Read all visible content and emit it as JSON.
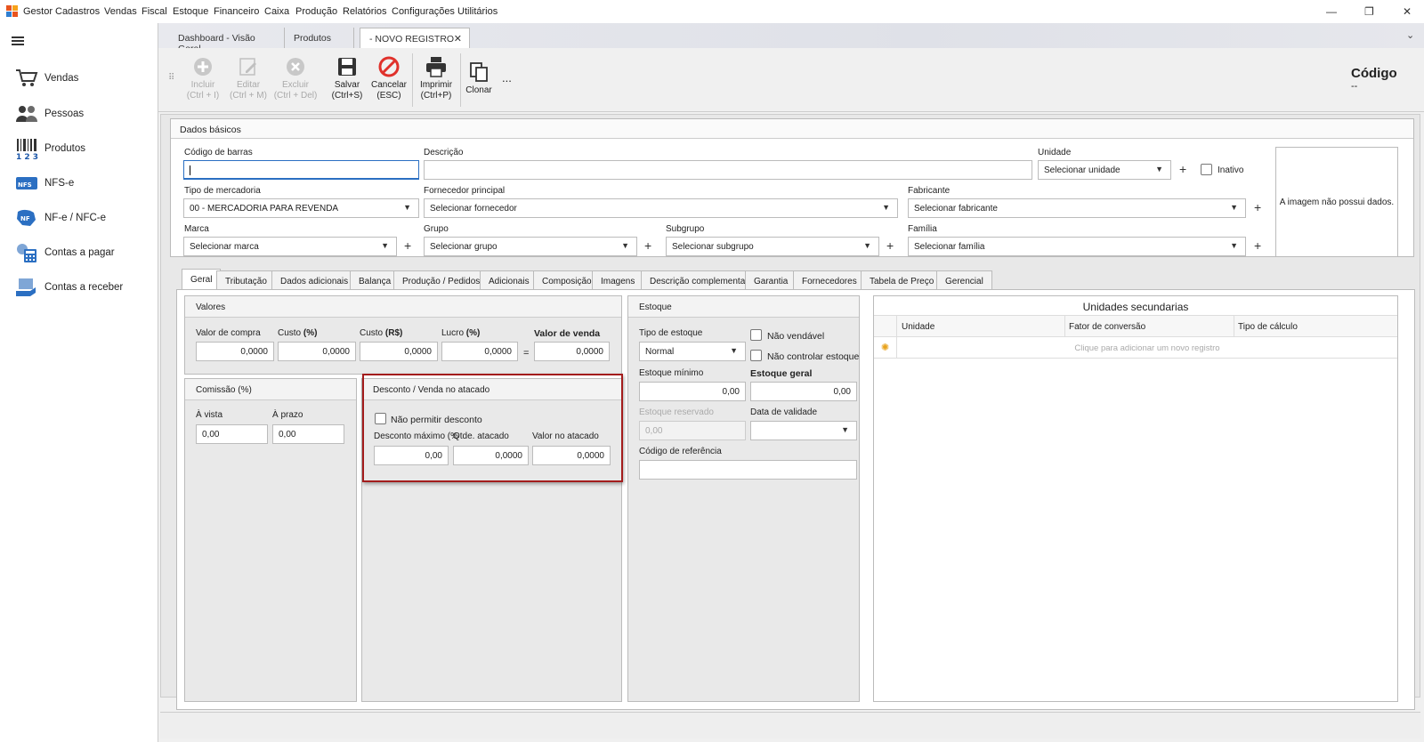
{
  "menu": {
    "items": [
      "Gestor",
      "Cadastros",
      "Vendas",
      "Fiscal",
      "Estoque",
      "Financeiro",
      "Caixa",
      "Produção",
      "Relatórios",
      "Configurações",
      "Utilitários"
    ]
  },
  "window": {
    "minimize": "—",
    "restore": "❐",
    "close": "✕"
  },
  "sidebar": {
    "items": [
      {
        "label": "Vendas",
        "icon": "cart-icon"
      },
      {
        "label": "Pessoas",
        "icon": "people-icon"
      },
      {
        "label": "Produtos",
        "icon": "barcode-icon"
      },
      {
        "label": "NFS-e",
        "icon": "nfse-icon"
      },
      {
        "label": "NF-e / NFC-e",
        "icon": "nfe-icon"
      },
      {
        "label": "Contas a pagar",
        "icon": "payable-icon"
      },
      {
        "label": "Contas a receber",
        "icon": "receivable-icon"
      }
    ]
  },
  "doc_tabs": [
    "Dashboard - Visão Geral",
    "Produtos",
    "- NOVO REGISTRO"
  ],
  "toolbar": {
    "incluir": [
      "Incluir",
      "(Ctrl + I)"
    ],
    "editar": [
      "Editar",
      "(Ctrl + M)"
    ],
    "excluir": [
      "Excluir",
      "(Ctrl + Del)"
    ],
    "salvar": [
      "Salvar",
      "(Ctrl+S)"
    ],
    "cancelar": [
      "Cancelar",
      "(ESC)"
    ],
    "imprimir": [
      "Imprimir",
      "(Ctrl+P)"
    ],
    "clonar": "Clonar",
    "more": "...",
    "codigo_label": "Código",
    "codigo_value": "--"
  },
  "basic": {
    "title": "Dados básicos",
    "codigo_barras": "Código de barras",
    "descricao": "Descrição",
    "unidade": "Unidade",
    "unidade_value": "Selecionar unidade",
    "inativo": "Inativo",
    "tipo_mercadoria": "Tipo de mercadoria",
    "tipo_mercadoria_value": "00 - MERCADORIA PARA REVENDA",
    "fornecedor": "Fornecedor principal",
    "fornecedor_value": "Selecionar fornecedor",
    "fabricante": "Fabricante",
    "fabricante_value": "Selecionar fabricante",
    "marca": "Marca",
    "marca_value": "Selecionar marca",
    "grupo": "Grupo",
    "grupo_value": "Selecionar grupo",
    "subgrupo": "Subgrupo",
    "subgrupo_value": "Selecionar subgrupo",
    "familia": "Família",
    "familia_value": "Selecionar família",
    "image_text": "A imagem não possui dados."
  },
  "page_tabs": [
    "Geral",
    "Tributação",
    "Dados adicionais",
    "Balança",
    "Produção / Pedidos",
    "Adicionais",
    "Composição",
    "Imagens",
    "Descrição complementar",
    "Garantia",
    "Fornecedores",
    "Tabela de Preço",
    "Gerencial"
  ],
  "valores": {
    "title": "Valores",
    "valor_compra": "Valor de compra",
    "custo_pct_a": "Custo ",
    "custo_pct_b": "(%)",
    "custo_rs_a": "Custo ",
    "custo_rs_b": "(R$)",
    "lucro_a": "Lucro ",
    "lucro_b": "(%)",
    "valor_venda": "Valor de venda",
    "equals": "=",
    "v_compra": "0,0000",
    "v_custo_pct": "0,0000",
    "v_custo_rs": "0,0000",
    "v_lucro": "0,0000",
    "v_venda": "0,0000"
  },
  "comissao": {
    "title": "Comissão (%)",
    "vista": "À vista",
    "prazo": "À prazo",
    "v_vista": "0,00",
    "v_prazo": "0,00"
  },
  "desconto": {
    "title": "Desconto / Venda no atacado",
    "nao_permitir": "Não permitir desconto",
    "desc_max": "Desconto máximo (%",
    "qtde": "Qtde. atacado",
    "valor_atacado": "Valor no atacado",
    "v_desc": "0,00",
    "v_qtde": "0,0000",
    "v_valor": "0,0000"
  },
  "estoque": {
    "title": "Estoque",
    "tipo": "Tipo de estoque",
    "tipo_value": "Normal",
    "nao_vendavel": "Não vendável",
    "nao_controlar": "Não controlar estoque",
    "minimo": "Estoque mínimo",
    "geral": "Estoque geral",
    "v_minimo": "0,00",
    "v_geral": "0,00",
    "reservado": "Estoque reservado",
    "v_reservado": "0,00",
    "validade": "Data de validade",
    "referencia": "Código de referência"
  },
  "unidades": {
    "title": "Unidades secundarias",
    "cols": [
      "Unidade",
      "Fator de conversão",
      "Tipo de cálculo"
    ],
    "add_hint": "Clique para adicionar um novo registro"
  },
  "colors": {
    "accent": "#2b6fc2",
    "highlight": "#a31c1c",
    "cancel": "#e0312b"
  }
}
